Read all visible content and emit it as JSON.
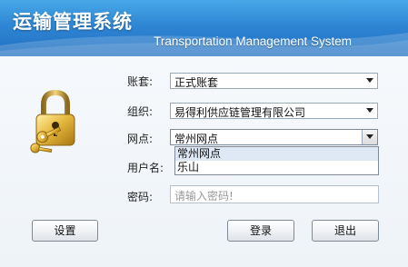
{
  "header": {
    "title": "运输管理系统",
    "subtitle": "Transportation Management System"
  },
  "form": {
    "account_label": "账套:",
    "account_value": "正式账套",
    "org_label": "组织:",
    "org_value": "易得利供应链管理有限公司",
    "site_label": "网点:",
    "site_value": "常州网点",
    "site_options": [
      "常州网点",
      "乐山"
    ],
    "user_label": "用户名:",
    "password_label": "密码:",
    "password_placeholder": "请输入密码!"
  },
  "buttons": {
    "settings": "设置",
    "login": "登录",
    "exit": "退出"
  },
  "colors": {
    "header_blue": "#2f86d4",
    "lock_gold": "#e2b23a"
  },
  "icons": {
    "lock": "padlock-with-keys-icon"
  }
}
